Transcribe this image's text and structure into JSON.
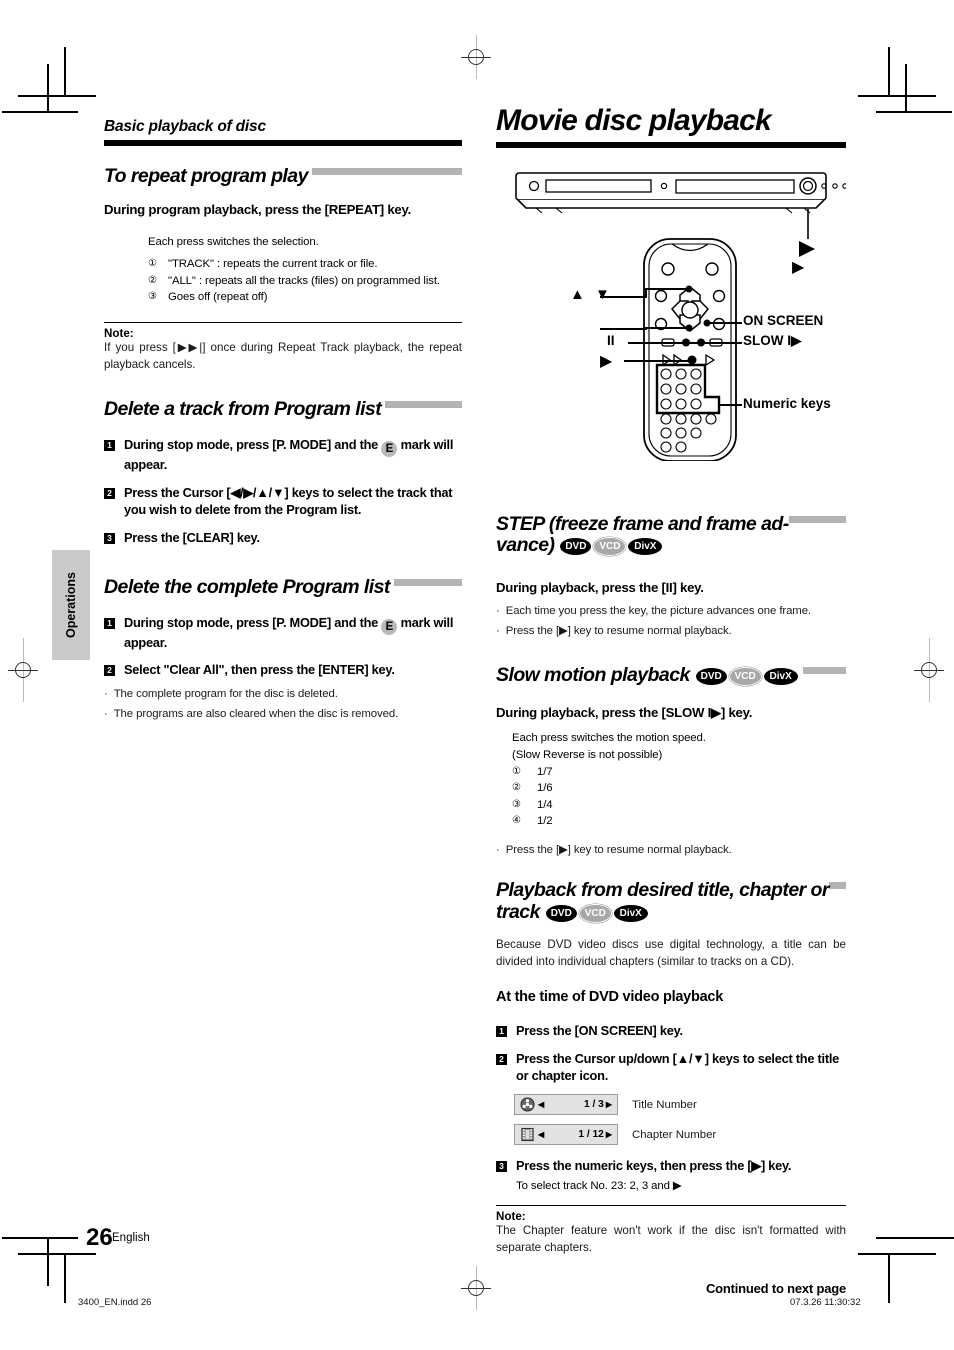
{
  "page": {
    "running_head": "Basic playback of disc",
    "chapter_title": "Movie disc playback",
    "side_tab": "Operations",
    "page_number": "26",
    "language": "English",
    "file_name": "3400_EN.indd   26",
    "timestamp": "07.3.26   11:30:32",
    "continued": "Continued to next page"
  },
  "left_column": {
    "repeat": {
      "heading": "To repeat program play",
      "instruction": "During program playback, press the [REPEAT] key.",
      "lead": "Each press switches the selection.",
      "options": [
        {
          "num": "①",
          "text": "\"TRACK\" : repeats the current track or file."
        },
        {
          "num": "②",
          "text": "\"ALL\" : repeats all the tracks (files) on programmed list."
        },
        {
          "num": "③",
          "text": "Goes off (repeat off)"
        }
      ],
      "note_label": "Note:",
      "note_text": "If you press [▶▶|] once during Repeat Track playback, the repeat playback cancels."
    },
    "delete_track": {
      "heading": "Delete a track from Program list",
      "steps": [
        {
          "num": "1",
          "text_before": "During stop mode, press [P. MODE] and the ",
          "badge": "E",
          "text_after": " mark will appear."
        },
        {
          "num": "2",
          "text_before": "Press the Cursor [◀/▶/▲/▼] keys to select the track that you wish to delete from the Program list.",
          "badge": "",
          "text_after": ""
        },
        {
          "num": "3",
          "text_before": "Press the [CLEAR] key.",
          "badge": "",
          "text_after": ""
        }
      ]
    },
    "delete_all": {
      "heading": "Delete the complete Program list",
      "steps": [
        {
          "num": "1",
          "text_before": "During stop mode, press [P. MODE] and the ",
          "badge": "E",
          "text_after": " mark will appear."
        },
        {
          "num": "2",
          "text_before": "Select \"Clear All\", then press the [ENTER] key.",
          "badge": "",
          "text_after": ""
        }
      ],
      "bullets": [
        "The complete program for the disc is deleted.",
        "The programs are also cleared when the disc is removed."
      ]
    }
  },
  "diagram": {
    "callouts": [
      {
        "name": "play-unit",
        "label": "▶"
      },
      {
        "name": "cursor-updown",
        "label": "▲ ▼"
      },
      {
        "name": "on-screen",
        "label": "ON SCREEN"
      },
      {
        "name": "slow",
        "label": "SLOW I▶"
      },
      {
        "name": "pause",
        "label": "II"
      },
      {
        "name": "play-remote",
        "label": "▶"
      },
      {
        "name": "numeric-keys",
        "label": "Numeric keys"
      }
    ]
  },
  "right_column": {
    "step_section": {
      "heading": "STEP (freeze frame and frame ad-vance)",
      "discs": [
        "DVD",
        "VCD",
        "DivX"
      ],
      "instruction": "During playback, press the [II] key.",
      "bullets": [
        "Each time you press the key, the picture advances one frame.",
        "Press the [▶] key to resume normal playback."
      ]
    },
    "slow_section": {
      "heading": "Slow motion playback",
      "discs": [
        "DVD",
        "VCD",
        "DivX"
      ],
      "instruction": "During playback, press the [SLOW I▶] key.",
      "lead1": "Each press switches the motion speed.",
      "lead2": "(Slow Reverse is not possible)",
      "speeds": [
        {
          "num": "①",
          "text": "1/7"
        },
        {
          "num": "②",
          "text": "1/6"
        },
        {
          "num": "③",
          "text": "1/4"
        },
        {
          "num": "④",
          "text": "1/2"
        }
      ],
      "bullets": [
        "Press the [▶] key to resume normal playback."
      ]
    },
    "desired_section": {
      "heading": "Playback from desired title, chapter or track",
      "discs": [
        "DVD",
        "VCD",
        "DivX"
      ],
      "intro": "Because DVD video discs use digital technology, a title can be divided into individual chapters (similar to tracks on a CD).",
      "subheading": "At the time of DVD video playback",
      "steps": [
        {
          "num": "1",
          "text": "Press the [ON SCREEN] key."
        },
        {
          "num": "2",
          "text": "Press the Cursor up/down [▲/▼] keys to select the title or chapter icon."
        }
      ],
      "osd": [
        {
          "icon": "film-reel-icon",
          "left_arrow": "◀",
          "value": "1 / 3",
          "right_arrow": "▶",
          "label": "Title Number"
        },
        {
          "icon": "film-strip-icon",
          "left_arrow": "◀",
          "value": "1 / 12",
          "right_arrow": "▶",
          "label": "Chapter Number"
        }
      ],
      "step3": {
        "num": "3",
        "text": "Press the numeric keys, then press the [▶] key."
      },
      "step3_sub": "To select track No. 23: 2, 3 and ▶",
      "note_label": "Note:",
      "note_text": "The Chapter feature won't work if the disc isn't formatted with separate chapters."
    }
  }
}
